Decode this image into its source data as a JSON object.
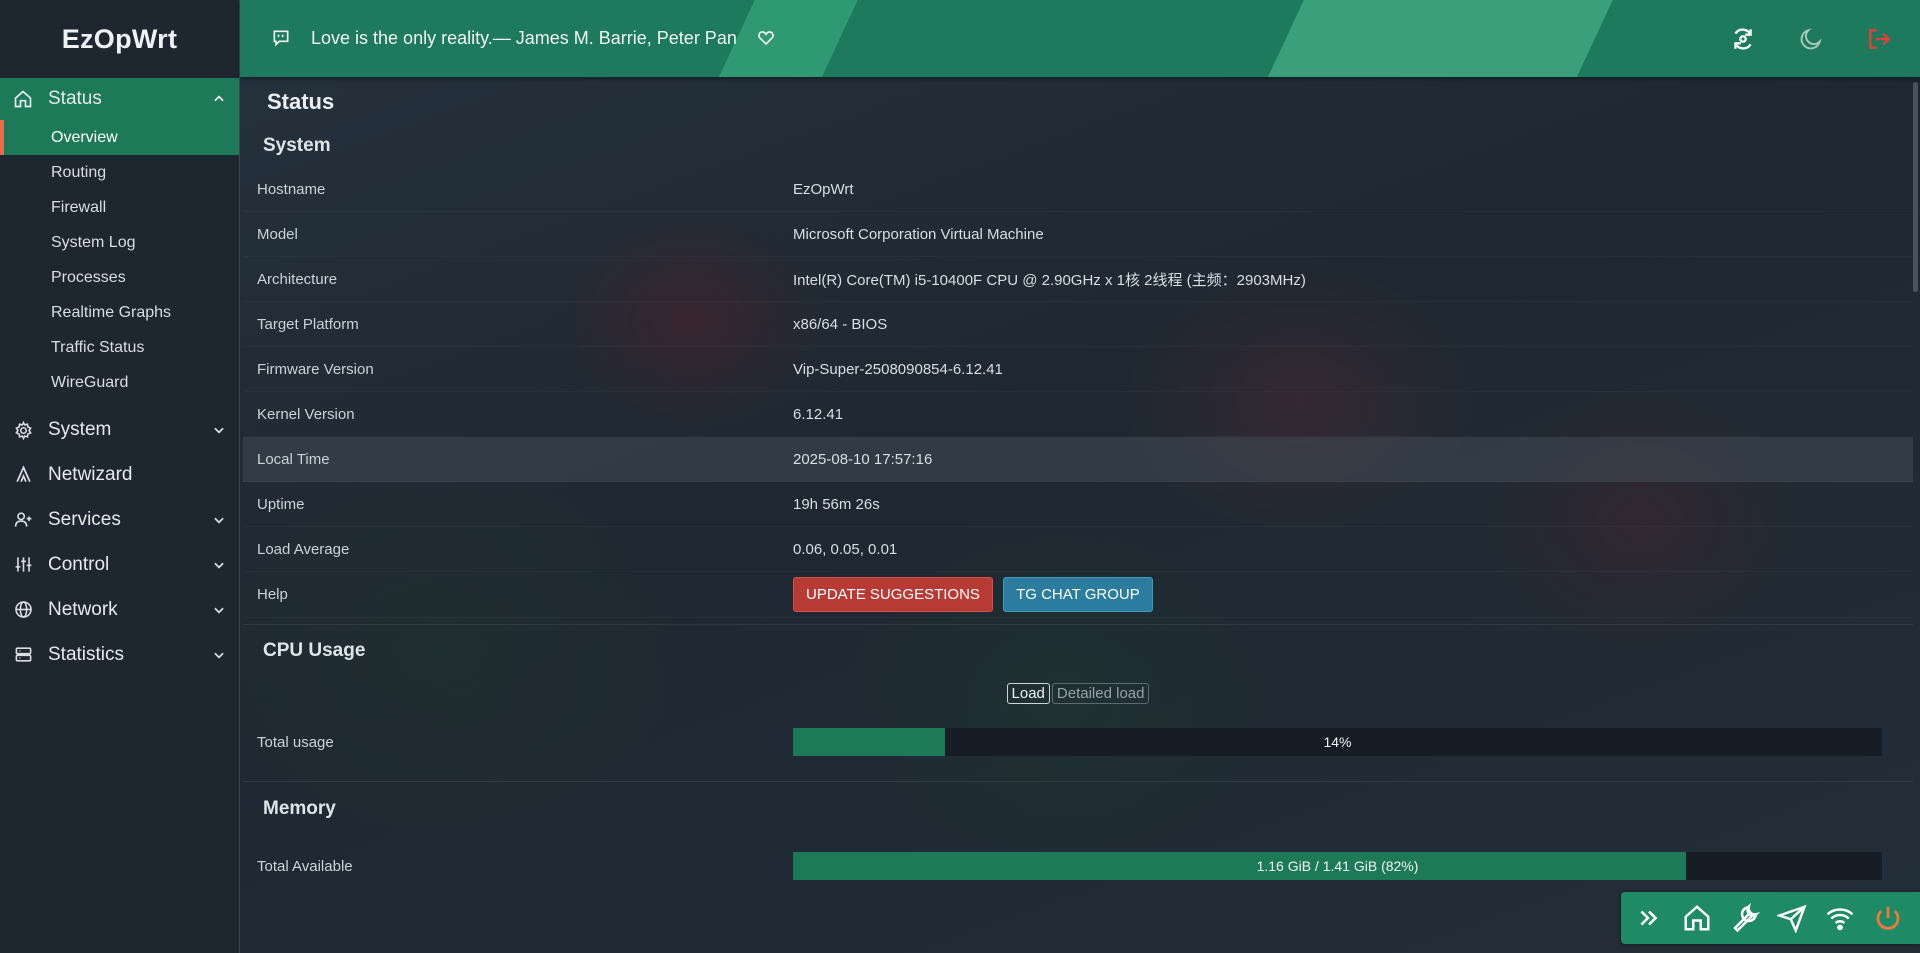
{
  "brand": "EzOpWrt",
  "header": {
    "quote": "Love is the only reality.— James M. Barrie, Peter Pan"
  },
  "sidebar": {
    "status_label": "Status",
    "status_items": [
      "Overview",
      "Routing",
      "Firewall",
      "System Log",
      "Processes",
      "Realtime Graphs",
      "Traffic Status",
      "WireGuard"
    ],
    "system_label": "System",
    "netwizard_label": "Netwizard",
    "services_label": "Services",
    "control_label": "Control",
    "network_label": "Network",
    "statistics_label": "Statistics"
  },
  "page": {
    "title": "Status"
  },
  "system": {
    "title": "System",
    "rows": [
      {
        "key": "Hostname",
        "value": "EzOpWrt"
      },
      {
        "key": "Model",
        "value": "Microsoft Corporation Virtual Machine"
      },
      {
        "key": "Architecture",
        "value": "Intel(R) Core(TM) i5-10400F CPU @ 2.90GHz x 1核 2线程 (主频：2903MHz)"
      },
      {
        "key": "Target Platform",
        "value": "x86/64 - BIOS"
      },
      {
        "key": "Firmware Version",
        "value": "Vip-Super-2508090854-6.12.41"
      },
      {
        "key": "Kernel Version",
        "value": "6.12.41"
      },
      {
        "key": "Local Time",
        "value": "2025-08-10 17:57:16"
      },
      {
        "key": "Uptime",
        "value": "19h 56m 26s"
      },
      {
        "key": "Load Average",
        "value": "0.06, 0.05, 0.01"
      }
    ],
    "help_label": "Help",
    "update_btn": "UPDATE SUGGESTIONS",
    "tg_btn": "TG CHAT GROUP"
  },
  "cpu": {
    "title": "CPU Usage",
    "tab_load": "Load",
    "tab_detailed": "Detailed load",
    "total_label": "Total usage",
    "percent": 14,
    "percent_text": "14%"
  },
  "memory": {
    "title": "Memory",
    "total_label": "Total Available",
    "percent": 82,
    "value_text": "1.16 GiB / 1.41 GiB (82%)"
  },
  "colors": {
    "accent": "#1d7a58",
    "danger": "#b83a35",
    "info": "#2b7c9e",
    "active_marker": "#e86c4d"
  },
  "icons": {
    "header": [
      "quote-icon",
      "heart-icon",
      "refresh-icon",
      "moon-icon",
      "logout-icon"
    ],
    "toolbar": [
      "chevrons-right-icon",
      "home-icon",
      "wrench-icon",
      "send-icon",
      "wifi-icon",
      "power-icon"
    ]
  }
}
